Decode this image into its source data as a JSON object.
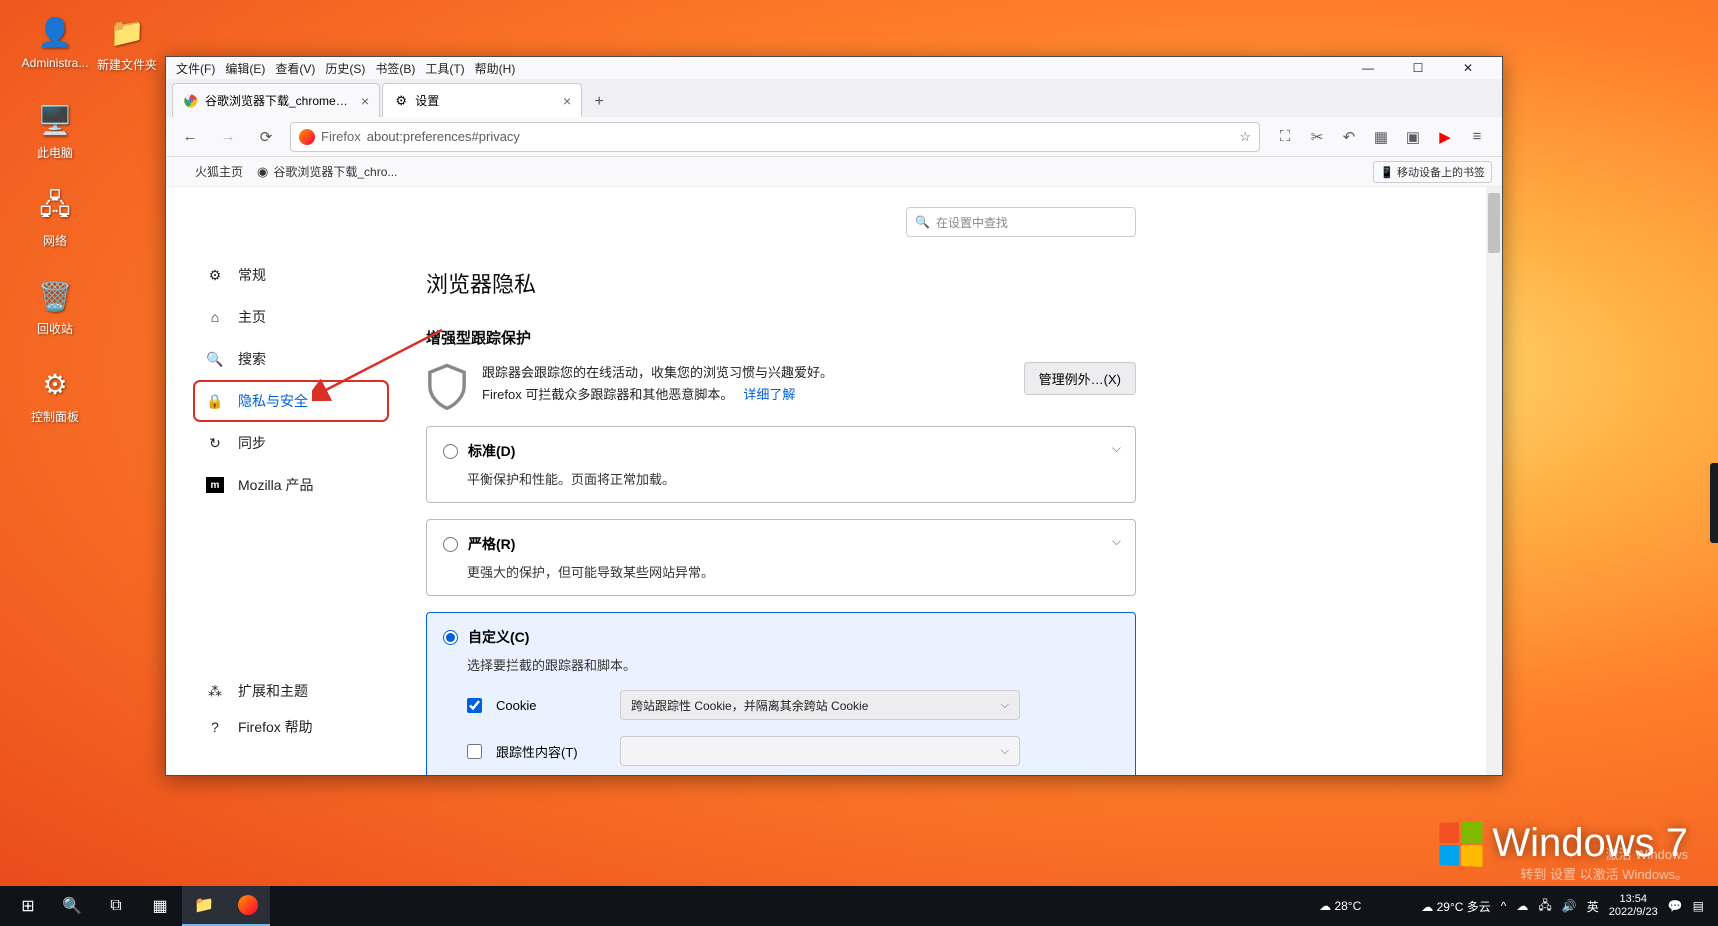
{
  "desktop": {
    "icons": [
      {
        "label": "Administra...",
        "glyph": "👤"
      },
      {
        "label": "新建文件夹",
        "glyph": "📁"
      },
      {
        "label": "此电脑",
        "glyph": "🖥️"
      },
      {
        "label": "网络",
        "glyph": "🖧"
      },
      {
        "label": "回收站",
        "glyph": "🗑️"
      },
      {
        "label": "控制面板",
        "glyph": "⚙"
      }
    ]
  },
  "menubar": [
    "文件(F)",
    "编辑(E)",
    "查看(V)",
    "历史(S)",
    "书签(B)",
    "工具(T)",
    "帮助(H)"
  ],
  "tabs": [
    {
      "label": "谷歌浏览器下载_chrome浏览器",
      "icon": "chrome"
    },
    {
      "label": "设置",
      "icon": "gear",
      "active": true
    }
  ],
  "url": {
    "prefix": "Firefox",
    "value": "about:preferences#privacy"
  },
  "bookmarks": {
    "items": [
      "火狐主页",
      "谷歌浏览器下载_chro..."
    ],
    "mobile": "移动设备上的书签"
  },
  "sidebar": {
    "items": [
      {
        "label": "常规",
        "icon": "gear"
      },
      {
        "label": "主页",
        "icon": "home"
      },
      {
        "label": "搜索",
        "icon": "search"
      },
      {
        "label": "隐私与安全",
        "icon": "lock",
        "active": true,
        "highlighted": true
      },
      {
        "label": "同步",
        "icon": "sync"
      },
      {
        "label": "Mozilla 产品",
        "icon": "moz"
      }
    ],
    "bottom": [
      {
        "label": "扩展和主题",
        "icon": "puzzle"
      },
      {
        "label": "Firefox 帮助",
        "icon": "help"
      }
    ]
  },
  "settings": {
    "search_placeholder": "在设置中查找",
    "page_title": "浏览器隐私",
    "section_title": "增强型跟踪保护",
    "desc_line1": "跟踪器会跟踪您的在线活动，收集您的浏览习惯与兴趣爱好。",
    "desc_line2": "Firefox 可拦截众多跟踪器和其他恶意脚本。",
    "learn_more": "详细了解",
    "manage_btn": "管理例外…(X)",
    "options": [
      {
        "title": "标准(D)",
        "desc": "平衡保护和性能。页面将正常加载。"
      },
      {
        "title": "严格(R)",
        "desc": "更强大的保护，但可能导致某些网站异常。"
      },
      {
        "title": "自定义(C)",
        "desc": "选择要拦截的跟踪器和脚本。",
        "selected": true
      }
    ],
    "custom": {
      "cookie_label": "Cookie",
      "cookie_dropdown": "跨站跟踪性 Cookie，并隔离其余跨站 Cookie",
      "tracking_label": "跟踪性内容(T)"
    }
  },
  "tray": {
    "weather_left": "28°C",
    "weather_right": "29°C 多云",
    "ime": "英",
    "time": "13:54",
    "date": "2022/9/23"
  },
  "watermark": {
    "title": "Windows 7",
    "sub1": "激活 Windows",
    "sub2": "转到 设置 以激活 Windows。"
  }
}
